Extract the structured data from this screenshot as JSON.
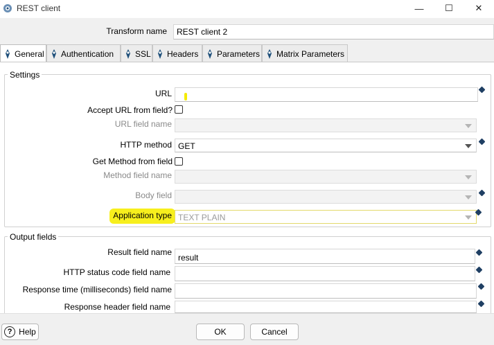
{
  "window": {
    "title": "REST client",
    "min_glyph": "—",
    "max_glyph": "☐",
    "close_glyph": "✕"
  },
  "transform": {
    "label": "Transform name",
    "value": "REST client 2"
  },
  "tabs": [
    {
      "label": "General"
    },
    {
      "label": "Authentication"
    },
    {
      "label": "SSL"
    },
    {
      "label": "Headers"
    },
    {
      "label": "Parameters"
    },
    {
      "label": "Matrix Parameters"
    }
  ],
  "settings": {
    "title": "Settings",
    "url_label": "URL",
    "url_value": "",
    "accept_url_label": "Accept URL from field?",
    "url_field_name_label": "URL field name",
    "http_method_label": "HTTP method",
    "http_method_value": "GET",
    "get_method_label": "Get Method from field",
    "method_field_name_label": "Method field name",
    "body_field_label": "Body field",
    "application_type_label": "Application type",
    "application_type_value": "TEXT PLAIN"
  },
  "output": {
    "title": "Output fields",
    "result_label": "Result field name",
    "result_value": "result",
    "status_label": "HTTP status code field name",
    "status_value": "",
    "response_time_label": "Response time (milliseconds) field name",
    "response_time_value": "",
    "response_header_label": "Response header field name",
    "response_header_value": ""
  },
  "footer": {
    "help_label": "Help",
    "help_glyph": "?",
    "ok_label": "OK",
    "cancel_label": "Cancel"
  },
  "colors": {
    "highlight": "#f7ef1d",
    "variable_diamond": "#1f3f63",
    "tab_icon": "#1e4f7a"
  }
}
